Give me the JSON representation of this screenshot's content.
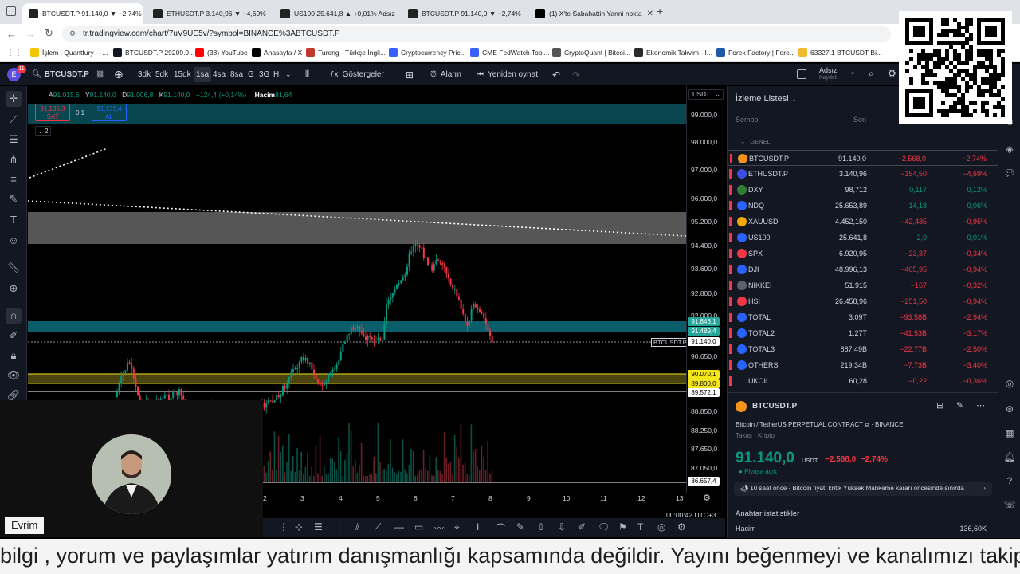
{
  "browser": {
    "tabs": [
      {
        "title": "BTCUSDT.P 91.140,0 ▼ −2,74%",
        "active": true
      },
      {
        "title": "ETHUSDT.P 3.140,96 ▼ −4,69%",
        "active": false
      },
      {
        "title": "US100 25.641,8 ▲ +0,01% Adsız",
        "active": false
      },
      {
        "title": "BTCUSDT.P 91.140,0 ▼ −2,74%",
        "active": false
      },
      {
        "title": "(1) X'te Sabahattin Yanni nokta",
        "active": false
      }
    ],
    "url": "tr.tradingview.com/chart/7uV9UE5v/?symbol=BINANCE%3ABTCUSDT.P",
    "bookmarks": [
      "İşlem | Quantfury —...",
      "BTCUSDT.P 29209.9...",
      "(38) YouTube",
      "Anasayfa / X",
      "Tureng - Türkçe İngil...",
      "Cryptocurrency Pric...",
      "CME FedWatch Tool...",
      "CryptoQuant | Bitcoi...",
      "Ekonomik Takvim - I...",
      "Forex Factory | Fore...",
      "63327.1 BTCUSDT Bi..."
    ]
  },
  "toolbar": {
    "avatar_letter": "E",
    "notif_count": "11",
    "symbol": "BTCUSDT.P",
    "timeframes": [
      "3dk",
      "5dk",
      "15dk",
      "1sa",
      "4sa",
      "8sa",
      "G",
      "3G",
      "H"
    ],
    "active_timeframe": "1sa",
    "indicators_label": "Göstergeler",
    "alarm_label": "Alarm",
    "replay_label": "Yeniden oynat",
    "layout_name": "Adsız",
    "layout_status": "Kaydet"
  },
  "legend": {
    "a_label": "A",
    "a_value": "91.015,6",
    "y_label": "Y",
    "y_value": "91.140,0",
    "d_label": "D",
    "d_value": "91.006,8",
    "k_label": "K",
    "k_value": "91.140,0",
    "change": "+124,4 (+0,14%)",
    "volume_label": "Hacim",
    "volume_value": "81,64",
    "sell_price": "91.135,3",
    "sell_label": "SAT",
    "spread": "0,1",
    "buy_price": "91.135,4",
    "buy_label": "AL",
    "collapsed_count": "2"
  },
  "price_scale": {
    "currency": "USDT",
    "labels": [
      "99.000,0",
      "98.000,0",
      "97.000,0",
      "96.000,0",
      "95.200,0",
      "94.400,0",
      "93.600,0",
      "92.800,0",
      "92.000,0",
      "90.650,0",
      "88.850,0",
      "88.250,0",
      "87.650,0",
      "87.050,0"
    ],
    "badges": [
      {
        "text": "91.846,1",
        "color": "#26a69a"
      },
      {
        "text": "91.489,4",
        "color": "#26a69a"
      },
      {
        "text": "91.140,0",
        "color": "#ffffff"
      },
      {
        "text": "90.070,1",
        "color": "#f5e51b"
      },
      {
        "text": "89.800,0",
        "color": "#f5e51b"
      },
      {
        "text": "89.572,1",
        "color": "#ffffff"
      },
      {
        "text": "86.657,4",
        "color": "#ffffff"
      }
    ],
    "symbol_tag": "BTCUSDT.P"
  },
  "time_scale": {
    "labels": [
      "2",
      "3",
      "4",
      "5",
      "6",
      "7",
      "8",
      "9",
      "10",
      "11",
      "12",
      "13"
    ],
    "clock": "00:00:42 UTC+3"
  },
  "watchlist": {
    "title": "İzleme Listesi",
    "col_symbol": "Sembol",
    "col_last": "Son",
    "section": "GENEL",
    "rows": [
      {
        "sym": "BTCUSDT.P",
        "last": "91.140,0",
        "chg": "−2.568,0",
        "pct": "−2,74%",
        "up": false,
        "color": "#f7931a"
      },
      {
        "sym": "ETHUSDT.P",
        "last": "3.140,96",
        "chg": "−154,50",
        "pct": "−4,69%",
        "up": false,
        "color": "#3c4fe0"
      },
      {
        "sym": "DXY",
        "last": "98,712",
        "chg": "0,117",
        "pct": "0,12%",
        "up": true,
        "color": "#2e7d32"
      },
      {
        "sym": "NDQ",
        "last": "25.653,89",
        "chg": "14,18",
        "pct": "0,06%",
        "up": true,
        "color": "#2962ff"
      },
      {
        "sym": "XAUUSD",
        "last": "4.452,150",
        "chg": "−42,485",
        "pct": "−0,95%",
        "up": false,
        "color": "#f2a900"
      },
      {
        "sym": "US100",
        "last": "25.641,8",
        "chg": "2,0",
        "pct": "0,01%",
        "up": true,
        "color": "#2962ff"
      },
      {
        "sym": "SPX",
        "last": "6.920,95",
        "chg": "−23,87",
        "pct": "−0,34%",
        "up": false,
        "color": "#f23645"
      },
      {
        "sym": "DJI",
        "last": "48.996,13",
        "chg": "−465,95",
        "pct": "−0,94%",
        "up": false,
        "color": "#2962ff"
      },
      {
        "sym": "NIKKEI",
        "last": "51.915",
        "chg": "−167",
        "pct": "−0,32%",
        "up": false,
        "color": "#5d606b"
      },
      {
        "sym": "HSI",
        "last": "26.458,96",
        "chg": "−251,50",
        "pct": "−0,94%",
        "up": false,
        "color": "#f23645"
      },
      {
        "sym": "TOTAL",
        "last": "3,09T",
        "chg": "−93,58B",
        "pct": "−2,94%",
        "up": false,
        "color": "#2962ff"
      },
      {
        "sym": "TOTAL2",
        "last": "1,27T",
        "chg": "−41,53B",
        "pct": "−3,17%",
        "up": false,
        "color": "#2962ff"
      },
      {
        "sym": "TOTAL3",
        "last": "887,49B",
        "chg": "−22,77B",
        "pct": "−2,50%",
        "up": false,
        "color": "#2962ff"
      },
      {
        "sym": "OTHERS",
        "last": "219,34B",
        "chg": "−7,73B",
        "pct": "−3,40%",
        "up": false,
        "color": "#2962ff"
      },
      {
        "sym": "UKOIL",
        "last": "60,28",
        "chg": "−0,22",
        "pct": "−0,36%",
        "up": false,
        "color": "#131722"
      }
    ]
  },
  "details": {
    "symbol": "BTCUSDT.P",
    "description": "Bitcoin / TetherUS PERPETUAL CONTRACT",
    "exchange": "BINANCE",
    "category": "Takas · Kripto",
    "price": "91.140,0",
    "currency": "USDT",
    "change": "−2.568,0",
    "change_pct": "−2,74%",
    "market_status": "Piyasa açık",
    "news": "10 saat önce · Bitcoin fiyatı kritik Yüksek Mahkeme kararı öncesinde sınırda",
    "stats_title": "Anahtar istatistikler",
    "volume_label": "Hacim",
    "volume_value": "136,60K"
  },
  "webcam": {
    "name": "Evrim"
  },
  "subtitle": "bilgi , yorum ve paylaşımlar yatırım danışmanlığı kapsamında değildir. Yayını beğenmeyi ve kanalımızı takip",
  "colors": {
    "up": "#089981",
    "down": "#f23645",
    "teal": "#26a69a",
    "yellow": "#f5e51b",
    "bg": "#131722"
  }
}
